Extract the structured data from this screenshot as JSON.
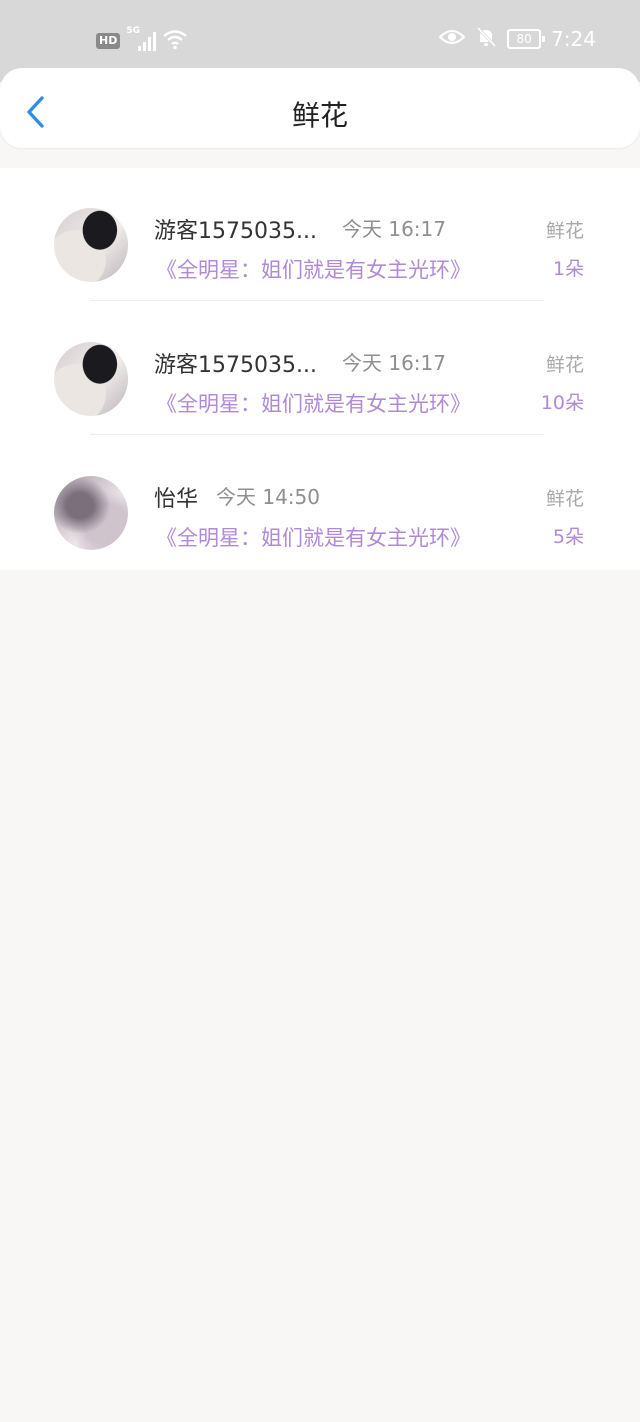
{
  "status_bar": {
    "hd_label": "HD",
    "network_label": "5G",
    "battery": "80",
    "time": "7:24"
  },
  "header": {
    "title": "鲜花"
  },
  "items": [
    {
      "name": "游客1575035...",
      "time": "今天 16:17",
      "title": "《全明星：姐们就是有女主光环》",
      "type": "鲜花",
      "count": "1朵"
    },
    {
      "name": "游客1575035...",
      "time": "今天 16:17",
      "title": "《全明星：姐们就是有女主光环》",
      "type": "鲜花",
      "count": "10朵"
    },
    {
      "name": "怡华",
      "time": "今天 14:50",
      "title": "《全明星：姐们就是有女主光环》",
      "type": "鲜花",
      "count": "5朵"
    }
  ],
  "colors": {
    "accent": "#b08ad8",
    "back_arrow": "#2f8fe0",
    "status_bar_bg": "#d8d8d8"
  }
}
